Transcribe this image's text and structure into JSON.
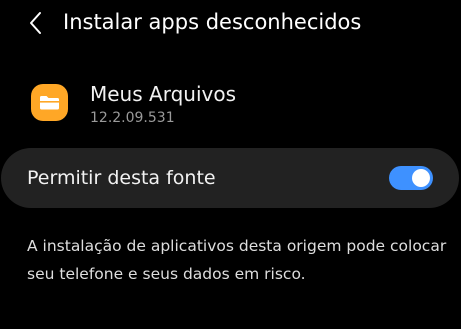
{
  "header": {
    "title": "Instalar apps desconhecidos",
    "back_icon": "chevron-left-icon"
  },
  "app": {
    "name": "Meus Arquivos",
    "version": "12.2.09.531",
    "icon": "folder-icon",
    "icon_color": "#ffa726"
  },
  "setting": {
    "label": "Permitir desta fonte",
    "enabled": true,
    "switch_color": "#3e91ff"
  },
  "warning": {
    "text": "A instalação de aplicativos desta origem pode colocar seu telefone e seus dados em risco."
  }
}
